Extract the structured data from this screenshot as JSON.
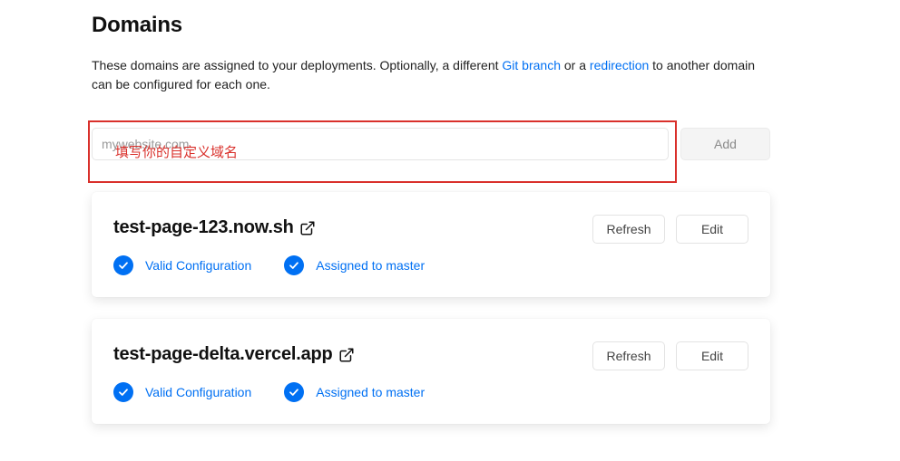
{
  "header": {
    "title": "Domains",
    "desc_part1": "These domains are assigned to your deployments. Optionally, a different ",
    "git_branch_link": "Git branch",
    "desc_part2": " or a ",
    "redirection_link": "redirection",
    "desc_part3": " to another domain can be configured for each one."
  },
  "add_form": {
    "placeholder": "mywebsite.com",
    "value": "",
    "annotation": "填写你的自定义域名",
    "add_label": "Add"
  },
  "domains": [
    {
      "name": "test-page-123.now.sh",
      "status_config": "Valid Configuration",
      "status_assigned": "Assigned to master",
      "refresh_label": "Refresh",
      "edit_label": "Edit"
    },
    {
      "name": "test-page-delta.vercel.app",
      "status_config": "Valid Configuration",
      "status_assigned": "Assigned to master",
      "refresh_label": "Refresh",
      "edit_label": "Edit"
    }
  ],
  "icons": {
    "external": "external-link-icon",
    "check": "check-circle-icon"
  },
  "colors": {
    "accent": "#0070f3",
    "annotation": "#d9302b"
  }
}
